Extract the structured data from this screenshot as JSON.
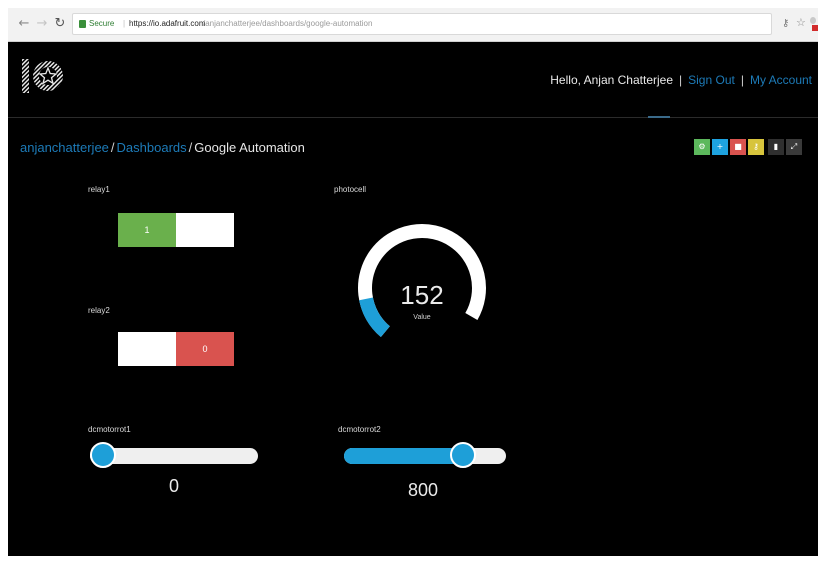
{
  "browser": {
    "secure_label": "Secure",
    "url_host": "https://io.adafruit.com",
    "url_path": "/anjanchatterjee/dashboards/google-automation"
  },
  "header": {
    "greeting": "Hello, Anjan Chatterjee",
    "separator": "|",
    "sign_out": "Sign Out",
    "my_account": "My Account"
  },
  "breadcrumb": {
    "user": "anjanchatterjee",
    "separator": "/",
    "section": "Dashboards",
    "current": "Google Automation"
  },
  "toolbar": {
    "buttons": [
      {
        "icon": "gear-icon",
        "color": "#5cb85c"
      },
      {
        "icon": "plus-icon",
        "color": "#1ea3e0"
      },
      {
        "icon": "trash-icon",
        "color": "#d9534f"
      },
      {
        "icon": "key-icon",
        "color": "#d7c43c"
      },
      {
        "icon": "lock-icon",
        "color": "#2f2f2f"
      },
      {
        "icon": "fullscreen-icon",
        "color": "#3a3a3a"
      }
    ]
  },
  "widgets": {
    "relay1": {
      "title": "relay1",
      "on_label": "1",
      "state": "on"
    },
    "relay2": {
      "title": "relay2",
      "off_label": "0",
      "state": "off"
    },
    "photocell": {
      "title": "photocell",
      "value": "152",
      "label": "Value",
      "fill_fraction": 0.15
    },
    "dcmotorrot1": {
      "title": "dcmotorrot1",
      "value": "0",
      "fill_fraction": 0.0
    },
    "dcmotorrot2": {
      "title": "dcmotorrot2",
      "value": "800",
      "fill_fraction": 0.78
    }
  },
  "colors": {
    "accent_blue": "#1e9fd8",
    "on_green": "#6ab04c",
    "off_red": "#d9534f",
    "link_blue": "#1d7bb8"
  }
}
